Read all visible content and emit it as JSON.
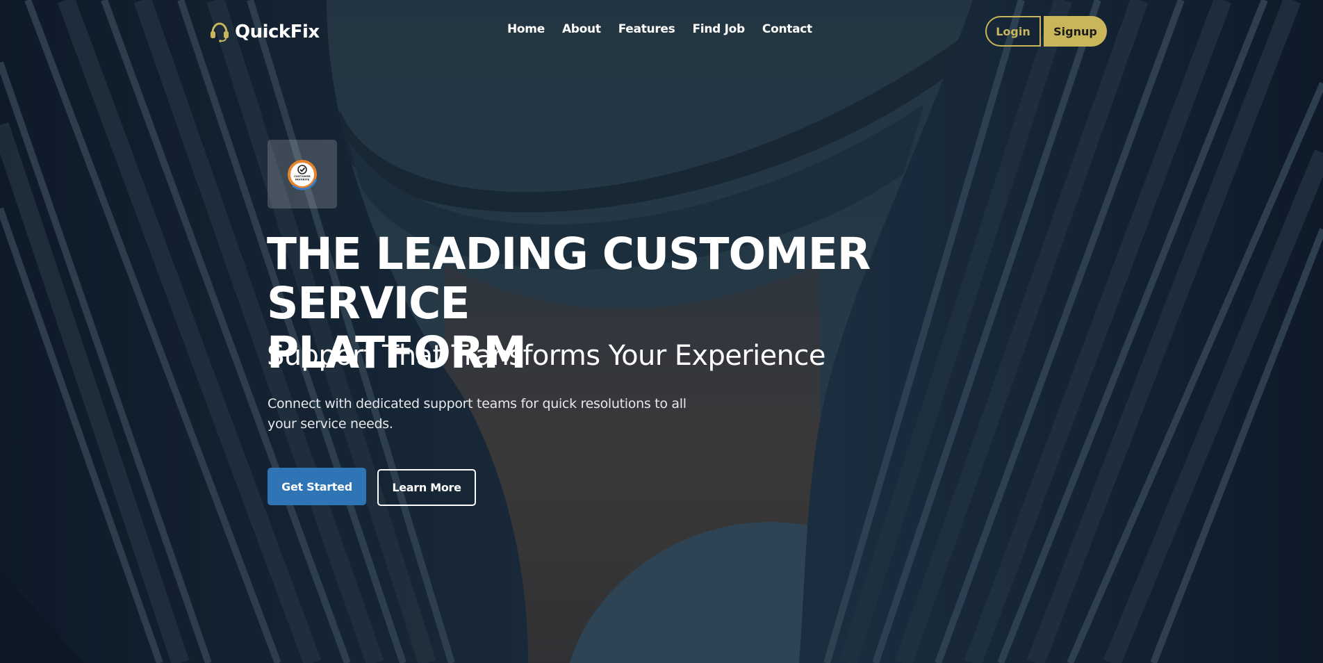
{
  "brand": {
    "name": "QuickFix",
    "icon": "headset-icon",
    "accent_color": "#c9b55a"
  },
  "nav": {
    "links": [
      "Home",
      "About",
      "Features",
      "Find Job",
      "Contact"
    ]
  },
  "auth": {
    "login_label": "Login",
    "signup_label": "Signup"
  },
  "hero": {
    "badge_icon": "customer-favorite-badge",
    "badge_text": "CUSTOMER FAVORITE",
    "title_line1": "THE LEADING CUSTOMER SERVICE",
    "title_line2": "PLATFORM",
    "subtitle": "Support That Transforms Your Experience",
    "description": "Connect with dedicated support teams for quick resolutions to all your service needs.",
    "primary_button": "Get Started",
    "secondary_button": "Learn More",
    "primary_color": "#2f74b5"
  }
}
